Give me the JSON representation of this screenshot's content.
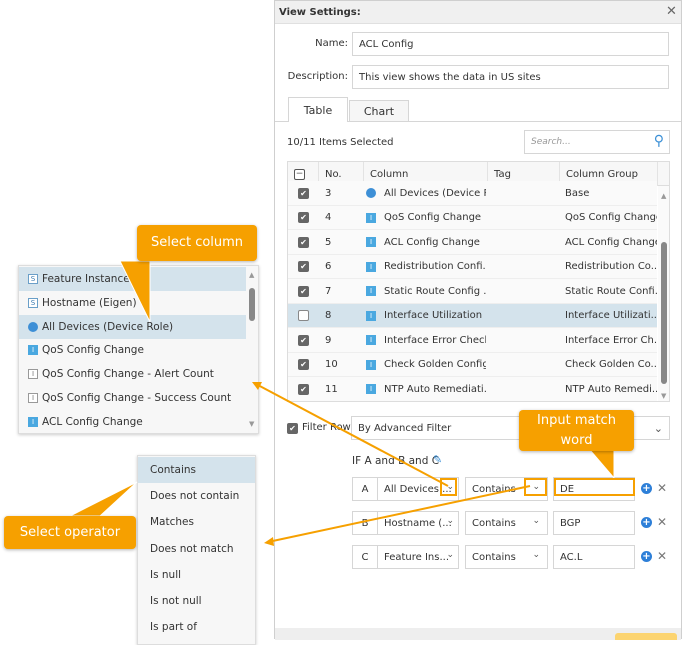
{
  "dialog": {
    "title": "View Settings:",
    "name_label": "Name:",
    "name_value": "ACL Config",
    "description_label": "Description:",
    "description_value": "This view shows the data in US sites"
  },
  "tabs": [
    {
      "label": "Table"
    },
    {
      "label": "Chart"
    }
  ],
  "selection_count": "10/11 Items Selected",
  "search": {
    "placeholder": "Search..."
  },
  "table": {
    "headers": [
      "No.",
      "Column",
      "Tag",
      "Column Group"
    ],
    "rows": [
      {
        "no": "3",
        "column": "All Devices (Device R...",
        "tag": "",
        "group": "Base",
        "checked": true
      },
      {
        "no": "4",
        "column": "QoS Config Change",
        "tag": "",
        "group": "QoS Config Change",
        "checked": true
      },
      {
        "no": "5",
        "column": "ACL Config Change",
        "tag": "",
        "group": "ACL Config Change",
        "checked": true
      },
      {
        "no": "6",
        "column": "Redistribution Confi...",
        "tag": "",
        "group": "Redistribution Co...",
        "checked": true
      },
      {
        "no": "7",
        "column": "Static Route Config ...",
        "tag": "",
        "group": "Static Route Confi...",
        "checked": true
      },
      {
        "no": "8",
        "column": "Interface Utilization ...",
        "tag": "",
        "group": "Interface Utilizati...",
        "checked": false
      },
      {
        "no": "9",
        "column": "Interface Error Check",
        "tag": "",
        "group": "Interface Error Ch...",
        "checked": true
      },
      {
        "no": "10",
        "column": "Check Golden Config",
        "tag": "",
        "group": "Check Golden Co...",
        "checked": true
      },
      {
        "no": "11",
        "column": "NTP Auto Remediati...",
        "tag": "",
        "group": "NTP Auto Remedi...",
        "checked": true
      }
    ]
  },
  "filter": {
    "label": "Filter Row",
    "mode": "By Advanced Filter",
    "expression": "IF A and B and C",
    "conditions": [
      {
        "letter": "A",
        "column": "All Devices ...",
        "operator": "Contains",
        "value": "DE"
      },
      {
        "letter": "B",
        "column": "Hostname (...",
        "operator": "Contains",
        "value": "BGP"
      },
      {
        "letter": "C",
        "column": "Feature Ins...",
        "operator": "Contains",
        "value": "AC.L"
      }
    ]
  },
  "column_dropdown": {
    "items": [
      "Feature Instance",
      "Hostname (Eigen)",
      "All Devices (Device Role)",
      "QoS Config Change",
      "QoS Config Change - Alert Count",
      "QoS Config Change - Success Count",
      "ACL Config Change"
    ]
  },
  "operator_dropdown": {
    "items": [
      "Contains",
      "Does not contain",
      "Matches",
      "Does not match",
      "Is null",
      "Is not null",
      "Is part of"
    ]
  },
  "callouts": {
    "select_column": "Select column",
    "select_operator": "Select operator",
    "input_match": "Input match word"
  },
  "colors": {
    "accent": "#f6a000",
    "selected_row": "#d4e3ec"
  }
}
